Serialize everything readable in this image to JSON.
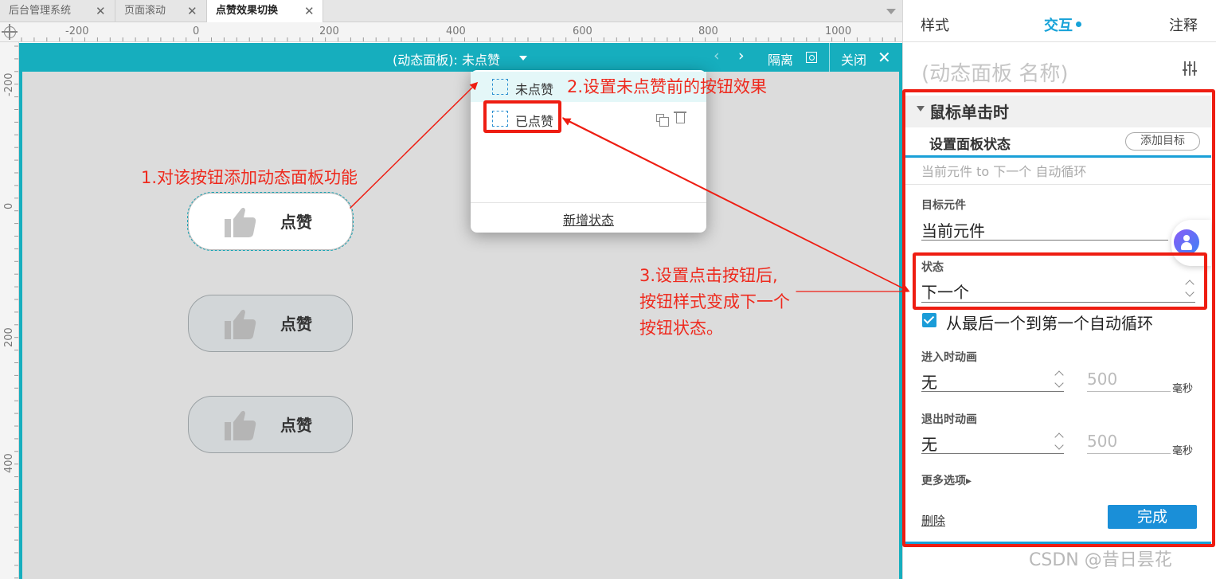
{
  "tabs": [
    {
      "label": "后台管理系统"
    },
    {
      "label": "页面滚动"
    },
    {
      "label": "点赞效果切换"
    }
  ],
  "ruler": {
    "top": [
      "-200",
      "0",
      "200",
      "400",
      "600",
      "800",
      "1000"
    ],
    "left": [
      "-200",
      "0",
      "200",
      "400"
    ]
  },
  "panel_header": {
    "title": "(动态面板): 未点赞",
    "prev": "‹",
    "next": "›",
    "isolate": "隔离",
    "close": "关闭",
    "close_icon": "✕"
  },
  "canvas": {
    "buttons": [
      {
        "label": "点赞",
        "state": "active"
      },
      {
        "label": "点赞",
        "state": "dim"
      },
      {
        "label": "点赞",
        "state": "dim"
      }
    ]
  },
  "states_popup": {
    "states": [
      {
        "name": "未点赞"
      },
      {
        "name": "已点赞"
      }
    ],
    "add_state": "新增状态"
  },
  "annotations": {
    "a1": "1.对该按钮添加动态面板功能",
    "a2": "2.设置未点赞前的按钮效果",
    "a3": [
      "3.设置点击按钮后,",
      "按钮样式变成下一个",
      "按钮状态。"
    ]
  },
  "right_panel": {
    "tabs": [
      "样式",
      "交互",
      "注释"
    ],
    "name_placeholder": "(动态面板 名称)",
    "event": "鼠标单击时",
    "action_title": "设置面板状态",
    "add_target": "添加目标",
    "action_desc": "当前元件 to 下一个 自动循环",
    "target_label": "目标元件",
    "target_value": "当前元件",
    "state_label": "状态",
    "state_value": "下一个",
    "loop_label": "从最后一个到第一个自动循环",
    "loop_checked": true,
    "enter_label": "进入时动画",
    "enter_value": "无",
    "enter_ms": "500",
    "exit_label": "退出时动画",
    "exit_value": "无",
    "exit_ms": "500",
    "ms_unit": "毫秒",
    "more_options": "更多选项▸",
    "delete": "删除",
    "done": "完成"
  },
  "watermark": "CSDN @昔日昙花",
  "colors": {
    "accent_teal": "#16aebe",
    "annotation_red": "#ee2a1e",
    "primary_blue": "#1a8fd8"
  }
}
